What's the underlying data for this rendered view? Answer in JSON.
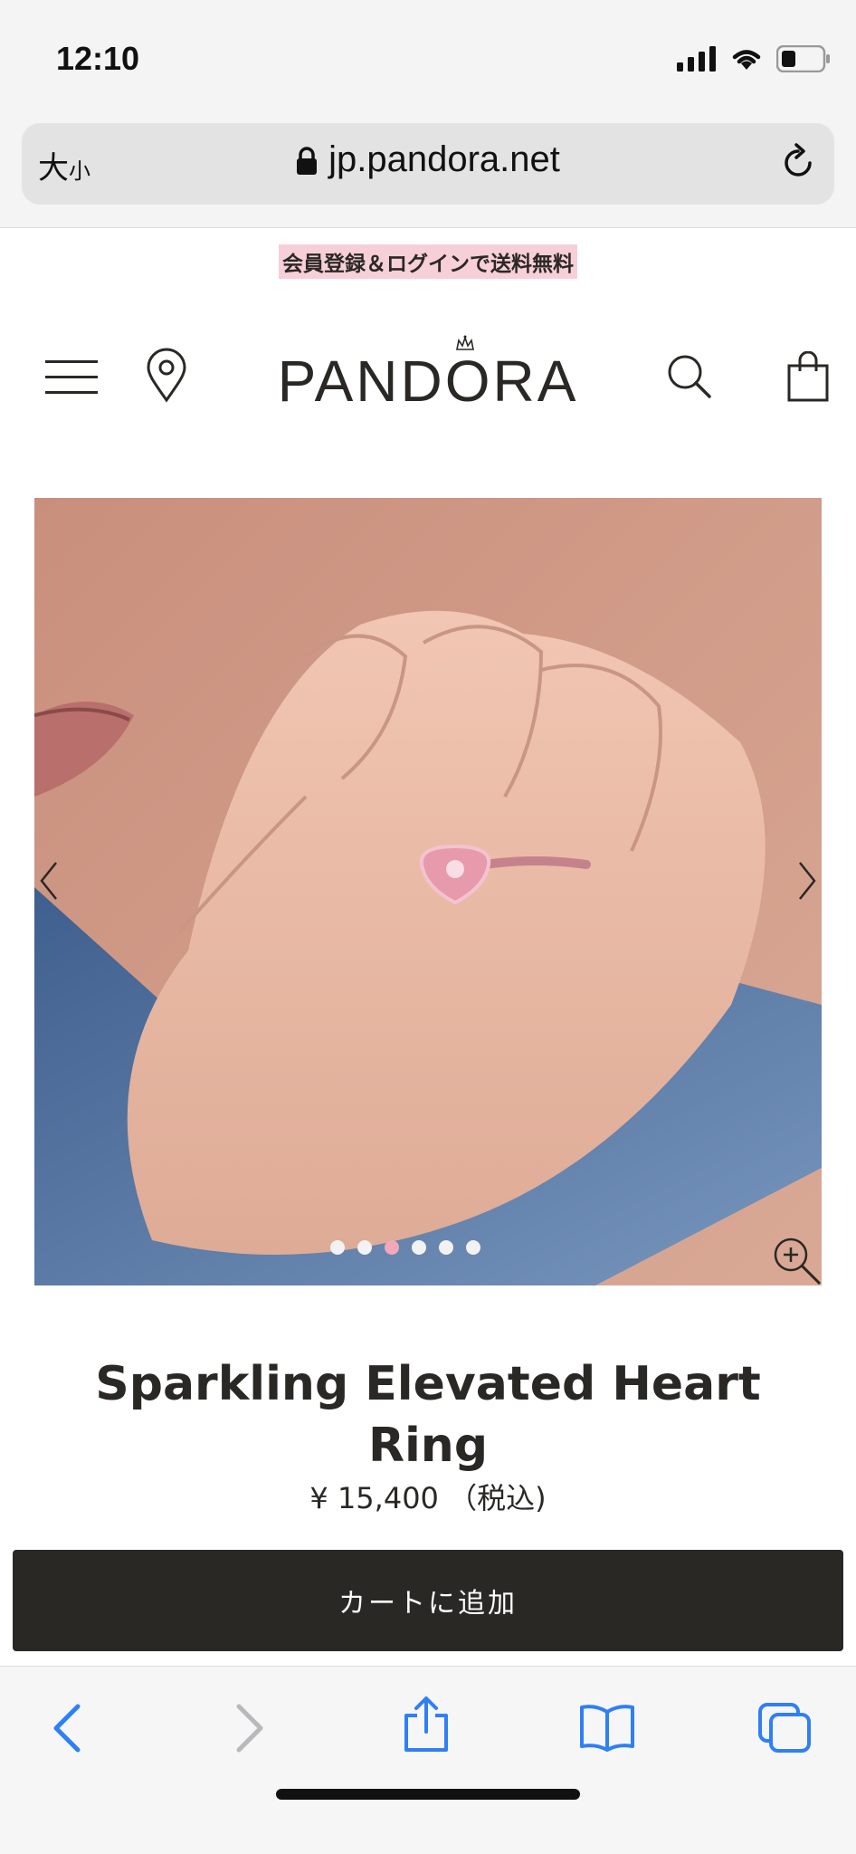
{
  "status_bar": {
    "time": "12:10",
    "icons": [
      "signal-icon",
      "wifi-icon",
      "battery-icon"
    ]
  },
  "browser": {
    "text_size_large": "大",
    "text_size_small": "小",
    "url": "jp.pandora.net"
  },
  "promo": {
    "text": "会員登録＆ログインで送料無料"
  },
  "header": {
    "logo": "PANDORA"
  },
  "gallery": {
    "dot_count": 6,
    "active_dot": 3
  },
  "product": {
    "title": "Sparkling Elevated Heart Ring",
    "price": "¥ 15,400 （税込)",
    "add_to_cart": "カートに追加"
  },
  "colors": {
    "brand_dark": "#2a2825",
    "promo_pink": "#f7cfd8",
    "ios_blue": "#2f7ff5",
    "active_dot": "#f2a8b8"
  }
}
